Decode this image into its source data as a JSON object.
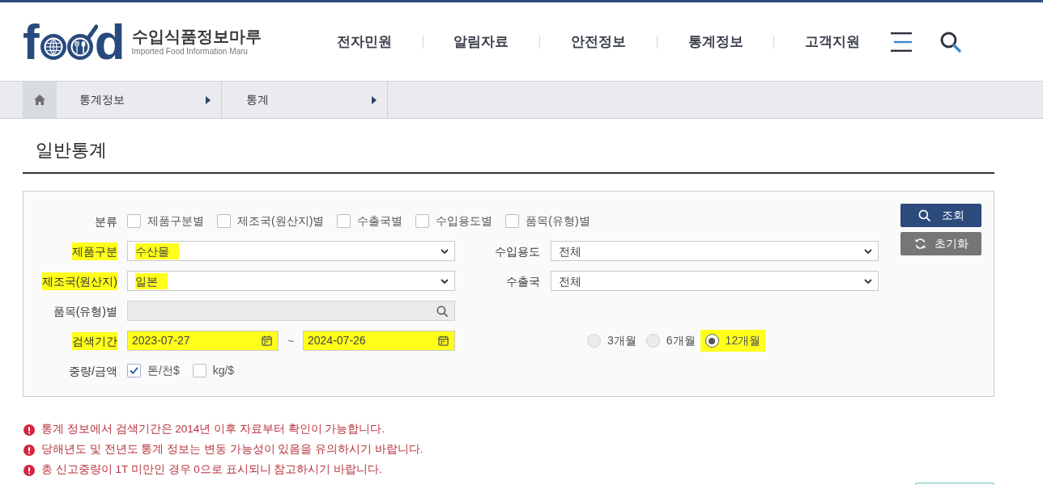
{
  "header": {
    "logo": {
      "letters": [
        "f",
        "d"
      ],
      "title": "수입식품정보마루",
      "subtitle": "Imported Food Information Maru"
    },
    "nav": [
      "전자민원",
      "알림자료",
      "안전정보",
      "통계정보",
      "고객지원"
    ]
  },
  "breadcrumb": [
    "통계정보",
    "통계"
  ],
  "page_title": "일반통계",
  "search_form": {
    "rows": [
      {
        "kind": "checkboxes",
        "label": "분류",
        "label_highlighted": false,
        "options": [
          {
            "label": "제품구분별",
            "checked": false
          },
          {
            "label": "제조국(원산지)별",
            "checked": false
          },
          {
            "label": "수출국별",
            "checked": false
          },
          {
            "label": "수입용도별",
            "checked": false
          },
          {
            "label": "품목(유형)별",
            "checked": false
          }
        ]
      },
      {
        "kind": "select",
        "label": "제품구분",
        "label_highlighted": true,
        "value": "수산물",
        "value_highlighted": true,
        "side": {
          "label": "수입용도",
          "value": "전체"
        }
      },
      {
        "kind": "select",
        "label": "제조국(원산지)",
        "label_highlighted": true,
        "value": "일본",
        "value_highlighted": true,
        "side": {
          "label": "수출국",
          "value": "전체"
        }
      },
      {
        "kind": "search",
        "label": "품목(유형)별",
        "label_highlighted": false
      },
      {
        "kind": "period",
        "label": "검색기간",
        "label_highlighted": true,
        "from": {
          "value": "2023-07-27",
          "highlighted": true
        },
        "separator": "~",
        "to": {
          "value": "2024-07-26",
          "highlighted": true
        },
        "presets": [
          {
            "label": "3개월",
            "selected": false,
            "highlighted": false
          },
          {
            "label": "6개월",
            "selected": false,
            "highlighted": false
          },
          {
            "label": "12개월",
            "selected": true,
            "highlighted": true
          }
        ]
      },
      {
        "kind": "checkboxes",
        "label": "중량/금액",
        "label_highlighted": false,
        "options": [
          {
            "label": "톤/천$",
            "checked": true
          },
          {
            "label": "kg/$",
            "checked": false
          }
        ]
      }
    ],
    "buttons": [
      {
        "kind": "search",
        "label": "조회"
      },
      {
        "kind": "reset",
        "label": "초기화"
      }
    ]
  },
  "notices": [
    "통계 정보에서 검색기간은 2014년 이후 자료부터 확인이 가능합니다.",
    "당해년도 및 전년도 통계 정보는 변동 가능성이 있음을 유의하시기 바랍니다.",
    "총 신고중량이 1T 미만인 경우 0으로 표시되니 참고하시기 바랍니다."
  ]
}
